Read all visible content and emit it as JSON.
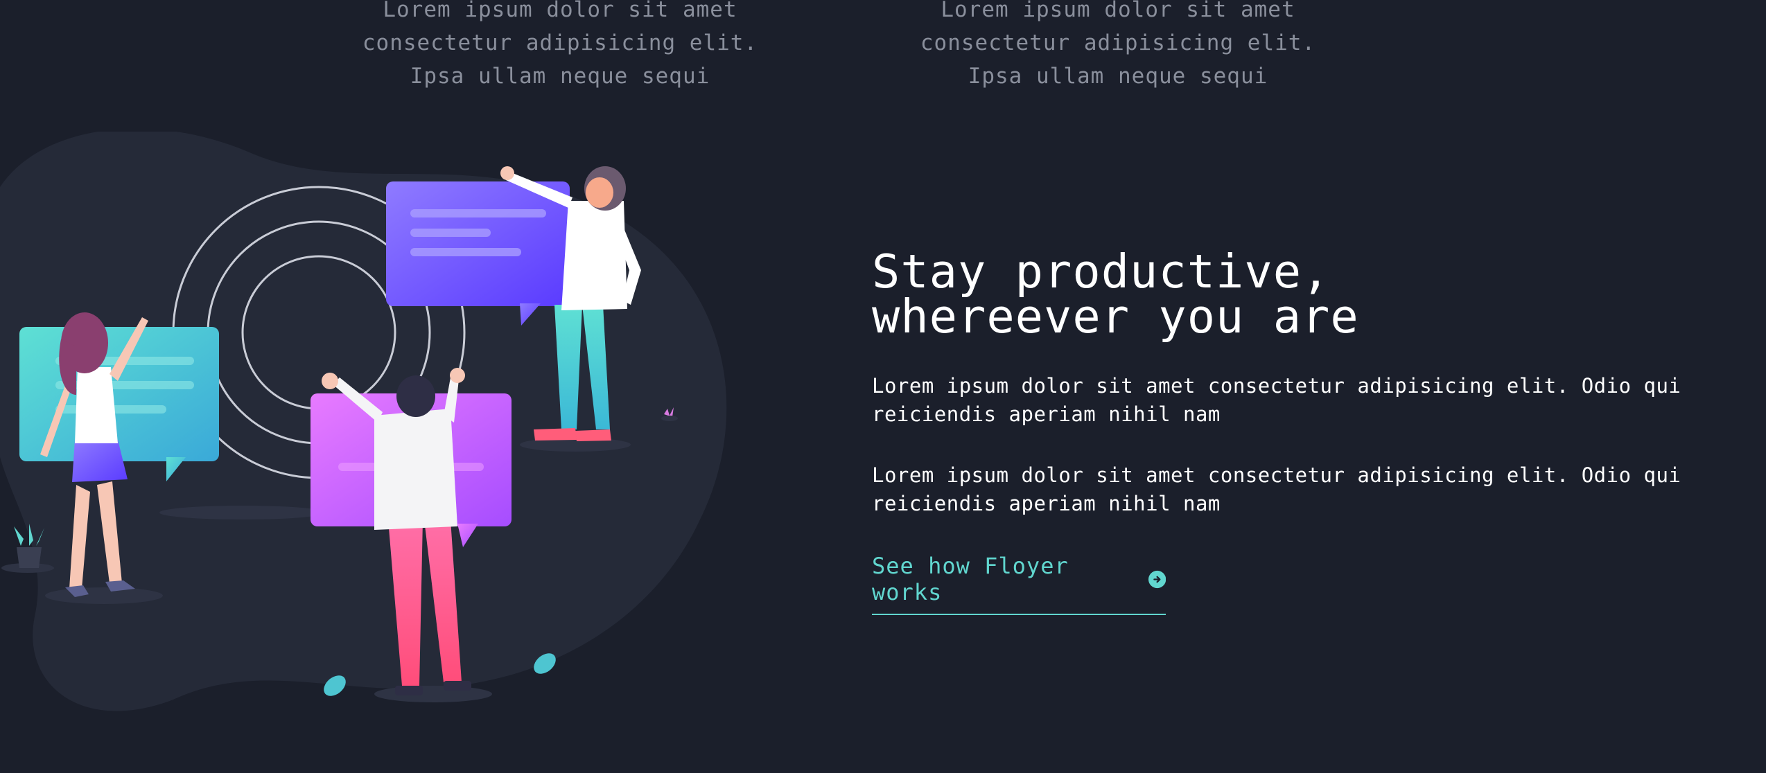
{
  "features": [
    {
      "text": "Lorem ipsum dolor sit amet consectetur adipisicing elit. Ipsa ullam neque sequi"
    },
    {
      "text": "Lorem ipsum dolor sit amet consectetur adipisicing elit. Ipsa ullam neque sequi"
    }
  ],
  "productive": {
    "headline_line1": "Stay productive,",
    "headline_line2": "whereever you are",
    "paragraph1": "Lorem ipsum dolor sit amet consectetur adipisicing elit. Odio qui reiciendis aperiam nihil nam",
    "paragraph2": "Lorem ipsum dolor sit amet consectetur adipisicing elit. Odio qui reiciendis aperiam nihil nam",
    "cta_label": "See how Floyer works",
    "cta_icon": "arrow-circle-right-icon"
  },
  "colors": {
    "background": "#1b1f2b",
    "accent": "#61d6cf",
    "muted_text": "#8a8f9c",
    "blob": "#252a38"
  }
}
